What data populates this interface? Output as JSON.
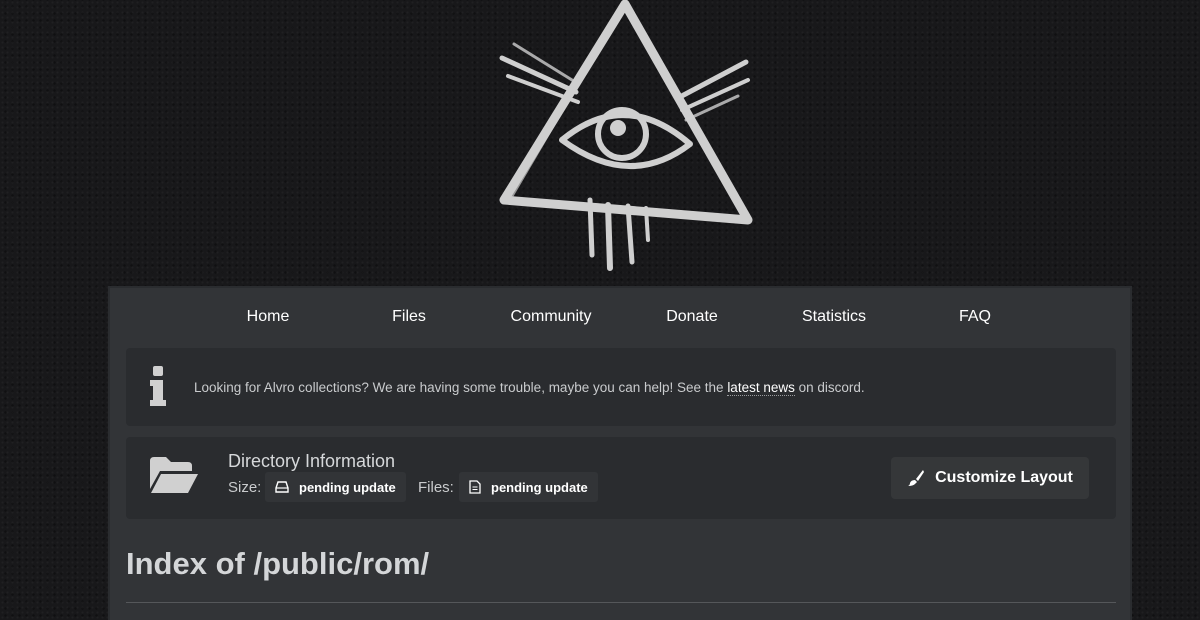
{
  "nav": {
    "items": [
      {
        "label": "Home"
      },
      {
        "label": "Files"
      },
      {
        "label": "Community"
      },
      {
        "label": "Donate"
      },
      {
        "label": "Statistics"
      },
      {
        "label": "FAQ"
      }
    ]
  },
  "notice": {
    "text_before": "Looking for Alvro collections? We are having some trouble, maybe you can help! See the ",
    "link_text": "latest news",
    "text_after": " on discord.",
    "icon": "info-icon"
  },
  "directory": {
    "title": "Directory Information",
    "size_label": "Size:",
    "size_value": "pending update",
    "files_label": "Files:",
    "files_value": "pending update",
    "icon": "folder-open-icon"
  },
  "customize_button": {
    "label": "Customize Layout",
    "icon": "brush-icon"
  },
  "page_title": "Index of /public/rom/",
  "colors": {
    "background": "#18181a",
    "panel": "#323437",
    "card": "#2a2c2f",
    "text": "#ffffff"
  }
}
